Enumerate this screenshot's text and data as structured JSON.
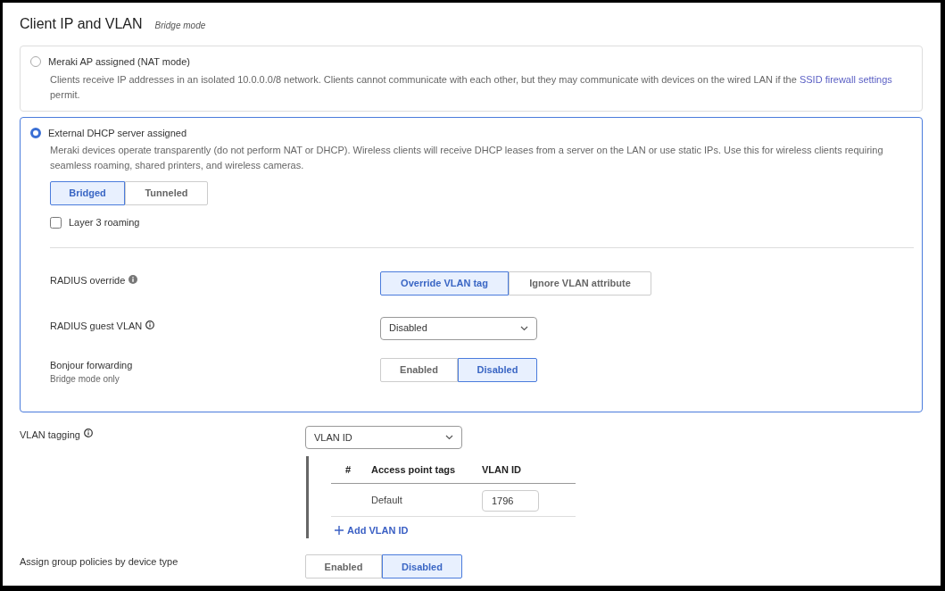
{
  "section": {
    "title": "Client IP and VLAN",
    "subtitle": "Bridge mode"
  },
  "modes": [
    {
      "label": "Meraki AP assigned (NAT mode)",
      "selected": false,
      "description": "Clients receive IP addresses in an isolated 10.0.0.0/8 network. Clients cannot communicate with each other, but they may communicate with devices on the wired LAN if the",
      "link": "SSID firewall settings",
      "description_after": "permit."
    },
    {
      "label": "External DHCP server assigned",
      "selected": true,
      "description": "Meraki devices operate transparently (do not perform NAT or DHCP). Wireless clients will receive DHCP leases from a server on the LAN or use static IPs. Use this for wireless clients requiring seamless roaming, shared printers, and wireless cameras."
    }
  ],
  "traffic_mode": [
    {
      "label": "Bridged",
      "selected": true
    },
    {
      "label": "Tunneled",
      "selected": false
    }
  ],
  "layer3_roaming": {
    "label": "Layer 3 roaming",
    "checked": false
  },
  "radius_override": {
    "label": "RADIUS override",
    "options": [
      {
        "label": "Override VLAN tag",
        "selected": true
      },
      {
        "label": "Ignore VLAN attribute",
        "selected": false
      }
    ]
  },
  "radius_guest_vlan": {
    "label": "RADIUS guest VLAN",
    "value": "Disabled"
  },
  "bonjour_forwarding": {
    "label": "Bonjour forwarding",
    "note": "Bridge mode only",
    "options": [
      {
        "label": "Enabled",
        "selected": false
      },
      {
        "label": "Disabled",
        "selected": true
      }
    ]
  },
  "vlan_tagging": {
    "label": "VLAN tagging",
    "value": "VLAN ID",
    "table": {
      "columns": [
        "#",
        "Access point tags",
        "VLAN ID"
      ],
      "rows": [
        {
          "tag": "Default",
          "vlan_id": "1796"
        }
      ]
    },
    "add_link": "Add VLAN ID"
  },
  "group_policies": {
    "label": "Assign group policies by device type",
    "options": [
      {
        "label": "Enabled",
        "selected": false
      },
      {
        "label": "Disabled",
        "selected": true
      }
    ]
  }
}
